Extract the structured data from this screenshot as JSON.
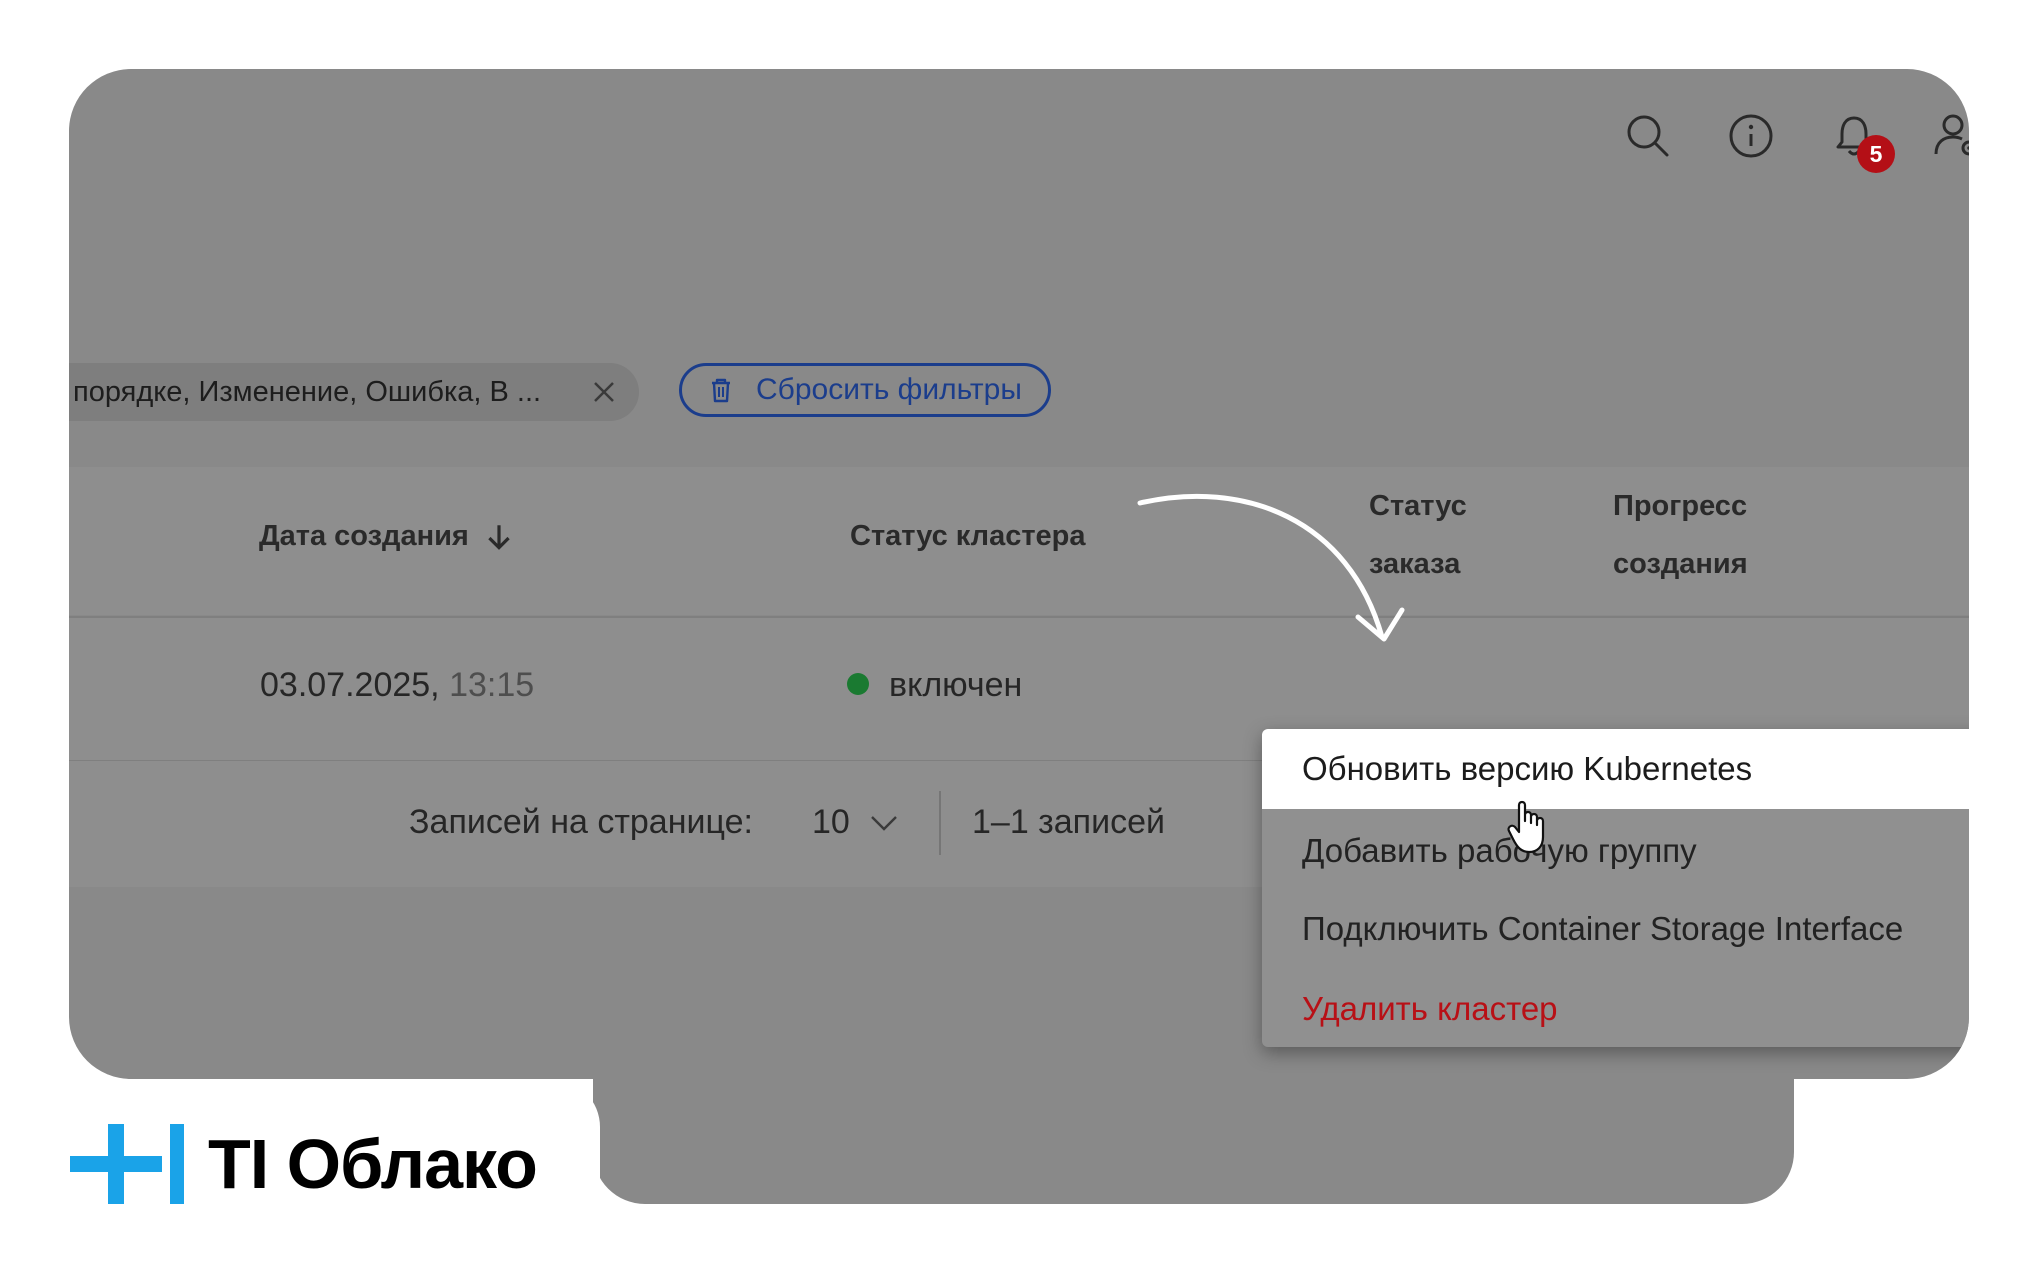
{
  "header": {
    "icons": [
      "search-icon",
      "info-icon",
      "bell-icon",
      "user-settings-icon"
    ],
    "notifications_count": "5"
  },
  "filters": {
    "chip_text": "порядке, Изменение, Ошибка, В ...",
    "reset_label": "Сбросить фильтры"
  },
  "table": {
    "columns": {
      "created_date": "Дата создания",
      "cluster_status": "Статус кластера",
      "order_status_line1": "Статус",
      "order_status_line2": "заказа",
      "progress_line1": "Прогресс",
      "progress_line2": "создания"
    },
    "rows": [
      {
        "date": "03.07.2025,",
        "time": "13:15",
        "cluster_status": "включен"
      }
    ]
  },
  "pagination": {
    "per_page_label": "Записей на странице:",
    "per_page_value": "10",
    "records_text": "1–1 записей"
  },
  "context_menu": {
    "items": [
      {
        "label": "Обновить версию Kubernetes"
      },
      {
        "label": "Добавить рабочую группу"
      },
      {
        "label": "Подключить Container Storage Interface"
      },
      {
        "label": "Удалить кластер"
      }
    ]
  },
  "logo": {
    "text": "TI Облако"
  },
  "colors": {
    "accent_blue": "#1b3d8c",
    "danger_red": "#b81016",
    "status_green": "#1a7a31",
    "logo_blue": "#1aa3e8"
  }
}
